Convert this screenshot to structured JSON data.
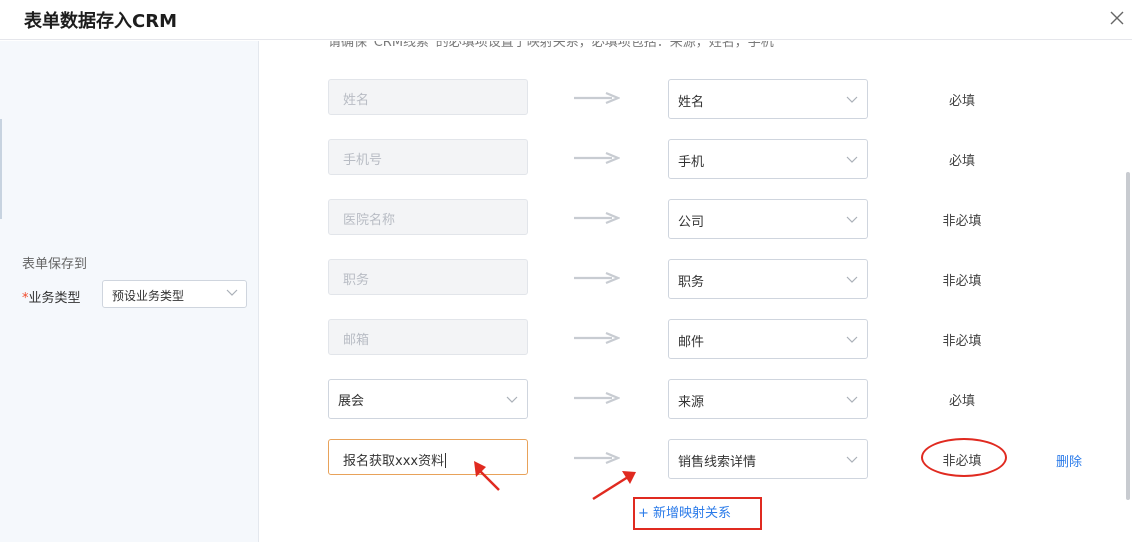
{
  "dialog": {
    "title": "表单数据存入CRM",
    "close_icon": "close-icon"
  },
  "left": {
    "save_to_label": "表单保存到",
    "business_type_label": "业务类型",
    "required_star": "*",
    "business_type_value": "预设业务类型"
  },
  "mapping": {
    "note": "请确保“CRM线索”的必填项设置了映射关系，必填项包括：来源，姓名，手机",
    "rows": [
      {
        "source": "姓名",
        "target": "姓名",
        "required": "必填"
      },
      {
        "source": "手机号",
        "target": "手机",
        "required": "必填"
      },
      {
        "source": "医院名称",
        "target": "公司",
        "required": "非必填"
      },
      {
        "source": "职务",
        "target": "职务",
        "required": "非必填"
      },
      {
        "source": "邮箱",
        "target": "邮件",
        "required": "非必填"
      },
      {
        "source": "展会",
        "target": "来源",
        "required": "必填"
      },
      {
        "source": "报名获取xxx资料",
        "target": "销售线索详情",
        "required": "非必填"
      }
    ],
    "delete_label": "删除",
    "add_label": "+ 新增映射关系"
  },
  "colors": {
    "accent": "#2b7be9",
    "annotation": "#e02a20",
    "required_star": "#f04a2a",
    "input_focus_border": "#e8a25a"
  }
}
